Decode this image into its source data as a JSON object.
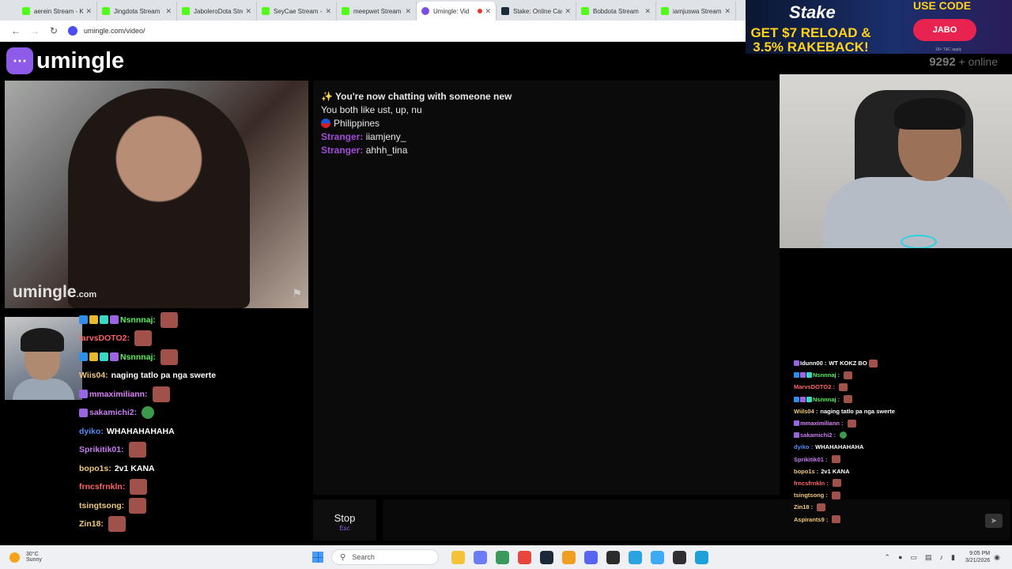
{
  "browser": {
    "tabs": [
      {
        "title": "aerein Stream - K",
        "icon": "kick-icon"
      },
      {
        "title": "Jingdota Stream",
        "icon": "kick-icon"
      },
      {
        "title": "JaboleroDota Stre",
        "icon": "kick-icon"
      },
      {
        "title": "SeyCae Stream -",
        "icon": "kick-icon"
      },
      {
        "title": "meepwet Stream",
        "icon": "kick-icon"
      },
      {
        "title": "Umingle: Vid",
        "icon": "umingle-icon",
        "active": true
      },
      {
        "title": "Stake: Online Cas",
        "icon": "stake-icon"
      },
      {
        "title": "Bobdota Stream",
        "icon": "kick-icon"
      },
      {
        "title": "iamjuswa Stream",
        "icon": "kick-icon"
      }
    ],
    "url": "umingle.com/video/"
  },
  "ad": {
    "brand": "Stake",
    "headline": "GET $7 RELOAD & 3.5% RAKEBACK!",
    "use_code_label": "USE CODE",
    "code": "JABO",
    "fine_print": "18+ T&C apply"
  },
  "site": {
    "logo_text": "umingle",
    "online_count": "9292",
    "online_suffix": "+ online",
    "watermark_main": "umingle",
    "watermark_tld": ".com"
  },
  "chat": {
    "intro": "✨ You're now chatting with someone new",
    "likes": "You both like ust, up, nu",
    "country": "Philippines",
    "messages": [
      {
        "sender": "Stranger:",
        "text": "iiamjeny_"
      },
      {
        "sender": "Stranger:",
        "text": "ahhh_tina"
      }
    ],
    "stop_label": "Stop",
    "stop_hint": "Esc"
  },
  "stream_chat_left": [
    {
      "user": "Nsnnnaj:",
      "text": "",
      "color": "#5cf05c",
      "badges": [
        "#2f8fe8",
        "#e8b92f",
        "#3cd6c5",
        "#9a65e0"
      ],
      "emote": "red"
    },
    {
      "user": "larvsDOTO2:",
      "text": "",
      "color": "#ff6464",
      "badges": [],
      "emote": "red"
    },
    {
      "user": "Nsnnnaj:",
      "text": "",
      "color": "#5cf05c",
      "badges": [
        "#2f8fe8",
        "#e8b92f",
        "#3cd6c5",
        "#9a65e0"
      ],
      "emote": "red"
    },
    {
      "user": "Wiis04:",
      "text": "naging tatlo pa nga swerte",
      "color": "#f0c97a",
      "badges": [],
      "emote": ""
    },
    {
      "user": "mmaximiliann:",
      "text": "",
      "color": "#d980f5",
      "badges": [
        "#9a65e0"
      ],
      "emote": "red"
    },
    {
      "user": "sakamichi2:",
      "text": "",
      "color": "#c87cf0",
      "badges": [
        "#9a65e0"
      ],
      "emote": "green"
    },
    {
      "user": "dyiko:",
      "text": "WHAHAHAHAHA",
      "color": "#4d8ef5",
      "badges": [],
      "emote": ""
    },
    {
      "user": "Sprikitik01:",
      "text": "",
      "color": "#c87cf0",
      "badges": [],
      "emote": "red"
    },
    {
      "user": "bopo1s:",
      "text": "2v1 KANA",
      "color": "#f0c97a",
      "badges": [],
      "emote": ""
    },
    {
      "user": "frncsfrnkln:",
      "text": "",
      "color": "#ff6464",
      "badges": [],
      "emote": "red"
    },
    {
      "user": "tsingtsong:",
      "text": "",
      "color": "#f0c97a",
      "badges": [],
      "emote": "red"
    },
    {
      "user": "Zin18:",
      "text": "",
      "color": "#f0c97a",
      "badges": [],
      "emote": "red"
    }
  ],
  "stream_chat_right": [
    {
      "user": "Idunn00 :",
      "text": "WT KOKZ BO",
      "color": "#ffffff",
      "badges": [
        "#9a65e0"
      ],
      "emote": "red"
    },
    {
      "user": "Nsnnnaj :",
      "text": "",
      "color": "#5cf05c",
      "badges": [
        "#2f8fe8",
        "#9a65e0",
        "#3cd6c5"
      ],
      "emote": "red"
    },
    {
      "user": "MarvsDOTO2 :",
      "text": "",
      "color": "#ff6464",
      "badges": [],
      "emote": "red"
    },
    {
      "user": "Nsnnnaj :",
      "text": "",
      "color": "#5cf05c",
      "badges": [
        "#2f8fe8",
        "#9a65e0",
        "#3cd6c5"
      ],
      "emote": "red"
    },
    {
      "user": "Wiils04 :",
      "text": "naging tatlo pa nga swerte",
      "color": "#f0c97a",
      "badges": [],
      "emote": ""
    },
    {
      "user": "mmaximiliann :",
      "text": "",
      "color": "#d980f5",
      "badges": [
        "#9a65e0"
      ],
      "emote": "red"
    },
    {
      "user": "sakamichi2 :",
      "text": "",
      "color": "#c87cf0",
      "badges": [
        "#9a65e0"
      ],
      "emote": "green"
    },
    {
      "user": "dyiko :",
      "text": "WHAHAHAHAHA",
      "color": "#4d8ef5",
      "badges": [],
      "emote": ""
    },
    {
      "user": "Sprikitik01 :",
      "text": "",
      "color": "#c87cf0",
      "badges": [],
      "emote": "red"
    },
    {
      "user": "bopo1s :",
      "text": "2v1 KANA",
      "color": "#f0c97a",
      "badges": [],
      "emote": ""
    },
    {
      "user": "frncsfrnkln :",
      "text": "",
      "color": "#ff6464",
      "badges": [],
      "emote": "red"
    },
    {
      "user": "tsingtsong :",
      "text": "",
      "color": "#f0c97a",
      "badges": [],
      "emote": "red"
    },
    {
      "user": "Zin18 :",
      "text": "",
      "color": "#f0c97a",
      "badges": [],
      "emote": "red"
    },
    {
      "user": "Aspirants9 :",
      "text": "",
      "color": "#f0c97a",
      "badges": [],
      "emote": "red"
    }
  ],
  "taskbar": {
    "weather_temp": "30°C",
    "weather_desc": "Sunny",
    "search_placeholder": "Search",
    "time": "9:05 PM",
    "date": "3/21/2026",
    "icons": [
      {
        "name": "file-explorer-icon",
        "color": "#f4c235"
      },
      {
        "name": "copilot-icon",
        "color": "#6b7cf5"
      },
      {
        "name": "chrome-beta-icon",
        "color": "#3a9a5b"
      },
      {
        "name": "chrome-icon",
        "color": "#e8453c"
      },
      {
        "name": "steam-icon",
        "color": "#1b2838"
      },
      {
        "name": "chrome-canary-icon",
        "color": "#f0a020"
      },
      {
        "name": "discord-icon",
        "color": "#5865f2"
      },
      {
        "name": "terminal-icon",
        "color": "#2b2b2b"
      },
      {
        "name": "telegram-icon",
        "color": "#2aa3e0"
      },
      {
        "name": "app-icon",
        "color": "#3fa9f5"
      },
      {
        "name": "obs-icon",
        "color": "#302e31"
      },
      {
        "name": "notepad-icon",
        "color": "#1fa0d8"
      }
    ]
  }
}
